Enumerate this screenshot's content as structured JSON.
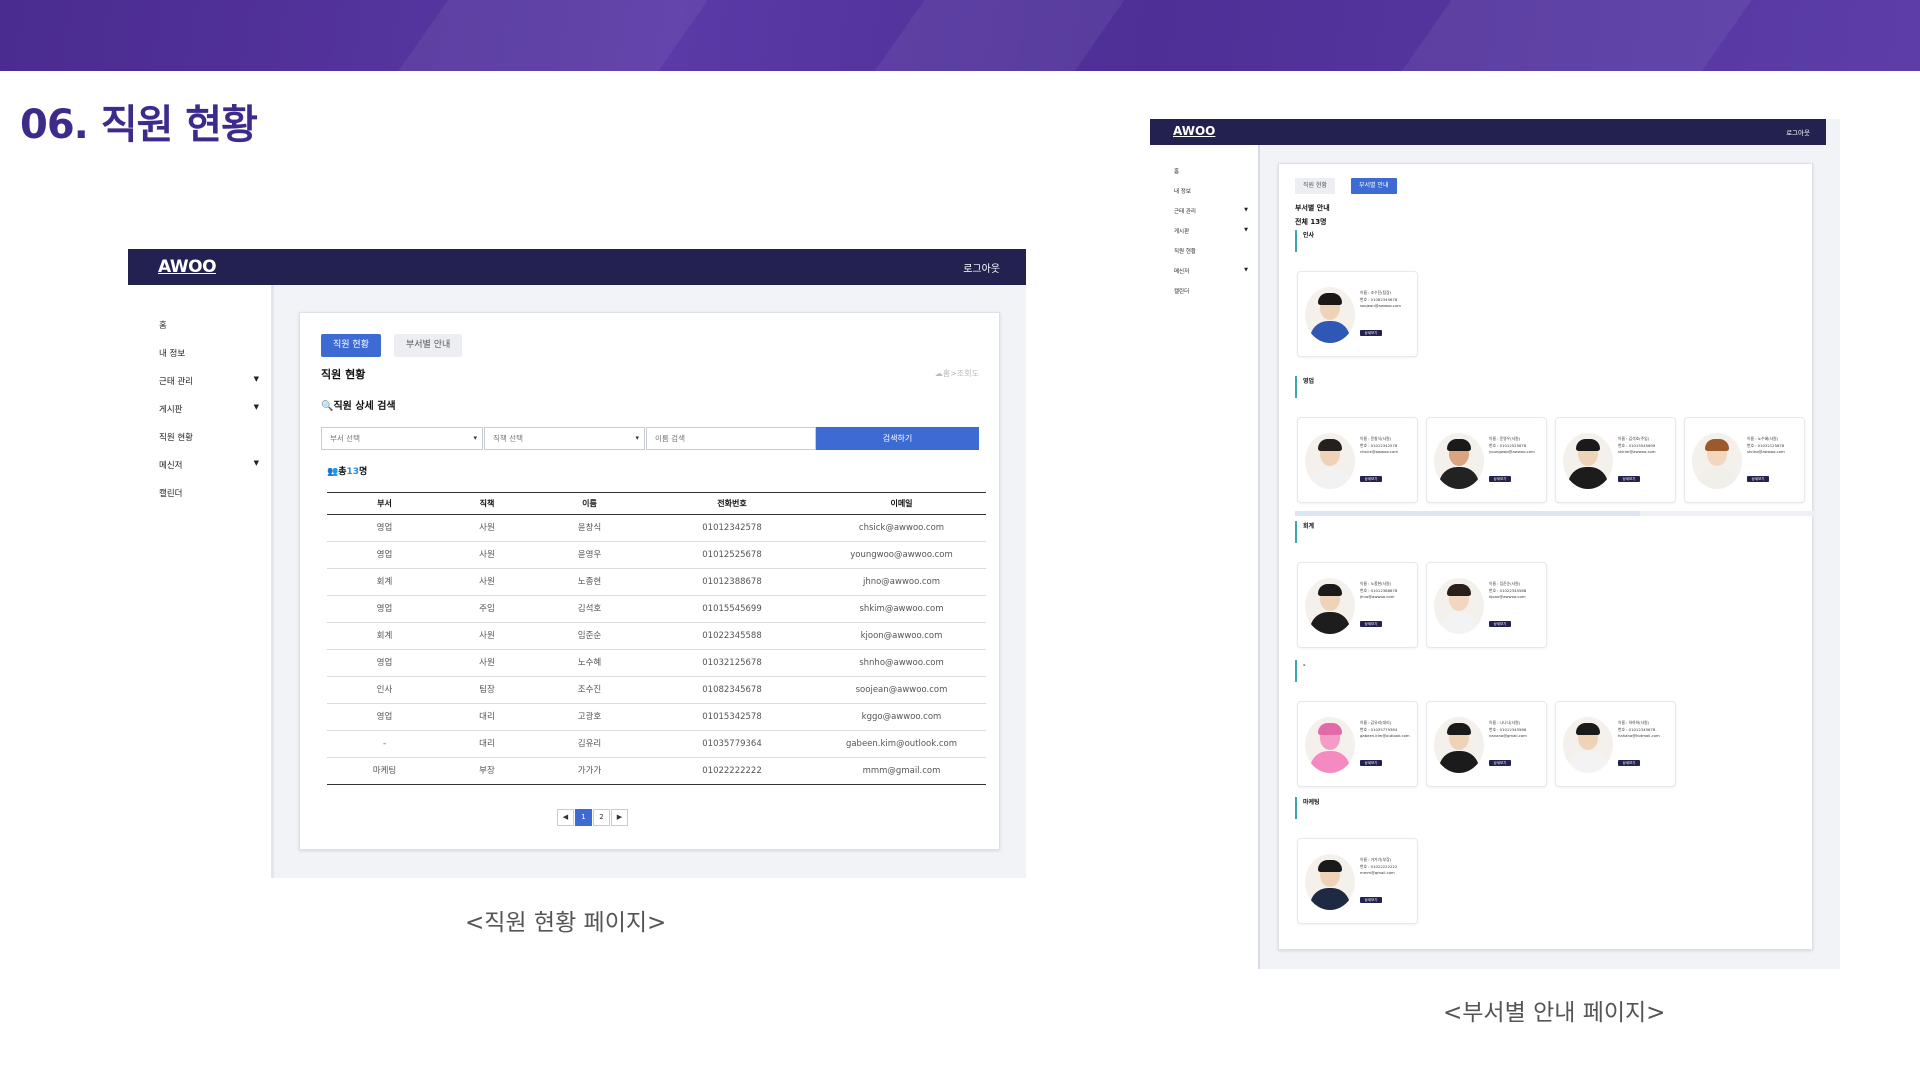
{
  "slide": {
    "title": "06. 직원 현황",
    "caption_left": "<직원 현황 페이지>",
    "caption_right": "<부서별 안내 페이지>"
  },
  "employee_page": {
    "logo": "AWOO",
    "logout": "로그아웃",
    "sidebar": [
      {
        "label": "홈",
        "caret": ""
      },
      {
        "label": "내 정보",
        "caret": ""
      },
      {
        "label": "근태 관리",
        "caret": "▼"
      },
      {
        "label": "게시판",
        "caret": "▼"
      },
      {
        "label": "직원 현황",
        "caret": ""
      },
      {
        "label": "메신저",
        "caret": "▼"
      },
      {
        "label": "캘린더",
        "caret": ""
      }
    ],
    "tabs": [
      "직원 현황",
      "부서별 안내"
    ],
    "title": "직원 현황",
    "breadcrumb": "☁홈>조회도",
    "search_title": "🔍직원 상세 검색",
    "dept_placeholder": "부서 선택",
    "position_placeholder": "직책 선택",
    "name_placeholder": "이름 검색",
    "search_button": "검색하기",
    "total_prefix": "👥총",
    "total_count": "13",
    "total_suffix": "명",
    "columns": [
      "부서",
      "직책",
      "이름",
      "전화번호",
      "이메일"
    ],
    "rows": [
      [
        "영업",
        "사원",
        "윤창식",
        "01012342578",
        "chsick@awwoo.com"
      ],
      [
        "영업",
        "사원",
        "윤영우",
        "01012525678",
        "youngwoo@awwoo.com"
      ],
      [
        "회계",
        "사원",
        "노종현",
        "01012388678",
        "jhno@awwoo.com"
      ],
      [
        "영업",
        "주임",
        "김석호",
        "01015545699",
        "shkim@awwoo.com"
      ],
      [
        "회계",
        "사원",
        "임준순",
        "01022345588",
        "kjoon@awwoo.com"
      ],
      [
        "영업",
        "사원",
        "노수혜",
        "01032125678",
        "shnho@awwoo.com"
      ],
      [
        "인사",
        "팀장",
        "조수진",
        "01082345678",
        "soojean@awwoo.com"
      ],
      [
        "영업",
        "대리",
        "고광호",
        "01015342578",
        "kggo@awwoo.com"
      ],
      [
        "-",
        "대리",
        "김유리",
        "01035779364",
        "gabeen.kim@outlook.com"
      ],
      [
        "마케팅",
        "부장",
        "가가가",
        "01022222222",
        "mmm@gmail.com"
      ]
    ],
    "pagination": [
      "◀",
      "1",
      "2",
      "▶"
    ]
  },
  "department_page": {
    "logo": "AWOO",
    "logout": "로그아웃",
    "sidebar": [
      {
        "label": "홈",
        "caret": ""
      },
      {
        "label": "내 정보",
        "caret": ""
      },
      {
        "label": "근태 관리",
        "caret": "▼"
      },
      {
        "label": "게시판",
        "caret": "▼"
      },
      {
        "label": "직원 현황",
        "caret": ""
      },
      {
        "label": "메신저",
        "caret": "▼"
      },
      {
        "label": "캘린더",
        "caret": ""
      }
    ],
    "tabs": [
      "직원 현황",
      "부서별 안내"
    ],
    "title": "부서별 안내",
    "total": "전체 13명",
    "detail_button": "상세보기",
    "departments": [
      {
        "name": "인사",
        "people": [
          {
            "name": "이름 : 조수진(팀장)",
            "phone": "번호 : 01082345678",
            "email": "soojean@awwoo.com",
            "skin": "#efd3b8",
            "hair": "#1b1716",
            "top": "#2f57b5"
          }
        ]
      },
      {
        "name": "영업",
        "people": [
          {
            "name": "이름 : 윤창식(사원)",
            "phone": "번호 : 01012342578",
            "email": "chsick@awwoo.com",
            "skin": "#efd3b8",
            "hair": "#24201d",
            "top": "#f2f2f2"
          },
          {
            "name": "이름 : 윤영우(사원)",
            "phone": "번호 : 01012525678",
            "email": "youngwoo@awwoo.com",
            "skin": "#d9a47f",
            "hair": "#1a1a1a",
            "top": "#222222"
          },
          {
            "name": "이름 : 김석호(주임)",
            "phone": "번호 : 01015545699",
            "email": "shkim@awwoo.com",
            "skin": "#efd3b8",
            "hair": "#1a1a1a",
            "top": "#1c1c1c"
          },
          {
            "name": "이름 : 노수혜(사원)",
            "phone": "번호 : 01032125678",
            "email": "shnho@awwoo.com",
            "skin": "#f2d6bf",
            "hair": "#9a5a2c",
            "top": "#f1efe9"
          }
        ]
      },
      {
        "name": "회계",
        "people": [
          {
            "name": "이름 : 노종현(사원)",
            "phone": "번호 : 01012388678",
            "email": "jhno@awwoo.com",
            "skin": "#efd3b8",
            "hair": "#1a1a1a",
            "top": "#1d1d1d"
          },
          {
            "name": "이름 : 임준순(사원)",
            "phone": "번호 : 01022345588",
            "email": "kjoon@awwoo.com",
            "skin": "#f2d6bf",
            "hair": "#2a1f1a",
            "top": "#f3f3f3"
          }
        ]
      },
      {
        "name": "-",
        "people": [
          {
            "name": "이름 : 김유리(대리)",
            "phone": "번호 : 01035779364",
            "email": "gabeen.kim@outlook.com",
            "skin": "#f39cc6",
            "hair": "#e36aa8",
            "top": "#f48ac0"
          },
          {
            "name": "이름 : 나나나(사원)",
            "phone": "번호 : 01012345566",
            "email": "nanana@gmail.com",
            "skin": "#efd3b8",
            "hair": "#1a1a1a",
            "top": "#1b1b1b"
          },
          {
            "name": "이름 : 하하하(사원)",
            "phone": "번호 : 01012345678",
            "email": "hahaha@hotmail.com",
            "skin": "#efd3b8",
            "hair": "#1a1a1a",
            "top": "#f3f3f3"
          }
        ]
      },
      {
        "name": "마케팅",
        "people": [
          {
            "name": "이름 : 가가가(부장)",
            "phone": "번호 : 01022222222",
            "email": "mmm@gmail.com",
            "skin": "#efd3b8",
            "hair": "#1a1a1a",
            "top": "#1e2a44"
          }
        ]
      }
    ]
  }
}
